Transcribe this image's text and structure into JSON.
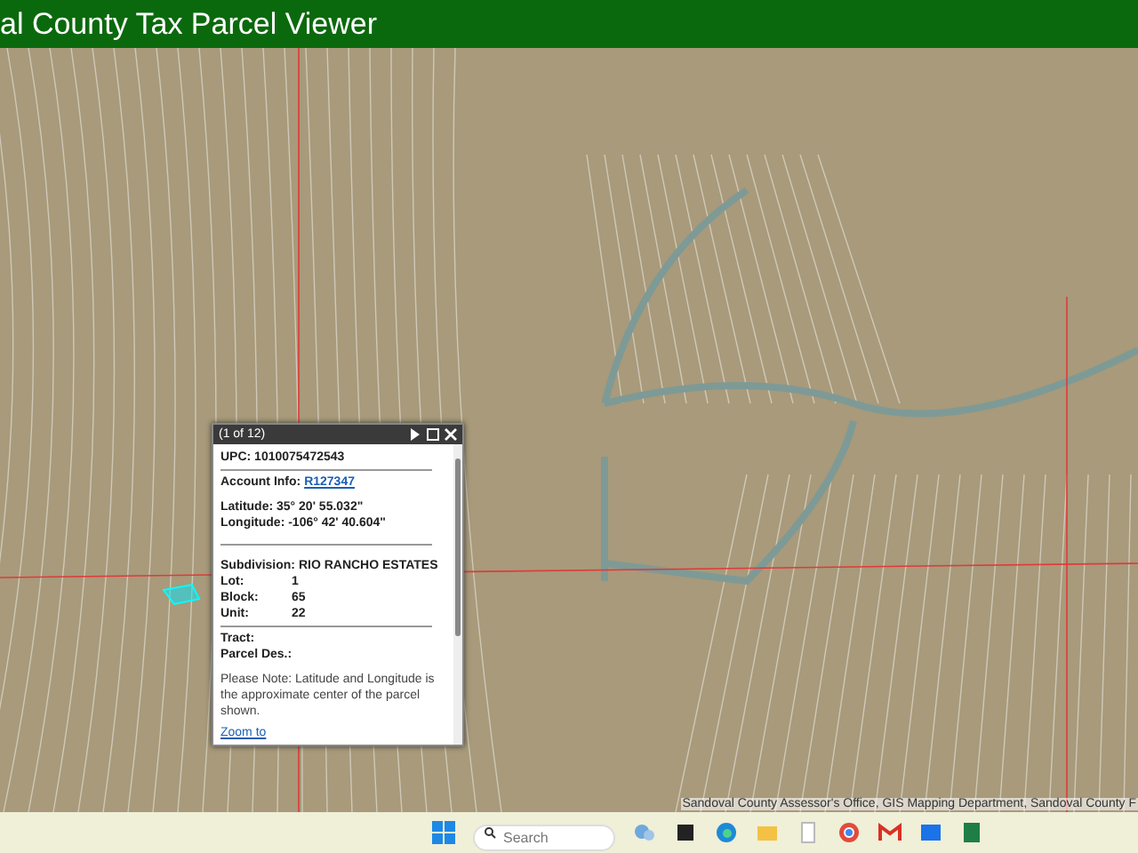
{
  "header": {
    "title": "al County Tax Parcel Viewer"
  },
  "popup": {
    "counter": "(1 of 12)",
    "rows": [
      {
        "kind": "field",
        "label": "UPC:",
        "value": "1010075472543"
      },
      {
        "kind": "rule"
      },
      {
        "kind": "link-field",
        "label": "Account Info:",
        "value": "R127347"
      },
      {
        "kind": "gap"
      },
      {
        "kind": "field",
        "label": "Latitude:",
        "value": "35° 20' 55.032\""
      },
      {
        "kind": "field",
        "label": "Longitude:",
        "value": "-106° 42' 40.604\""
      },
      {
        "kind": "gap"
      },
      {
        "kind": "rule"
      },
      {
        "kind": "gap"
      },
      {
        "kind": "field",
        "label": "Subdivision:",
        "value": "RIO RANCHO ESTATES"
      },
      {
        "kind": "grid",
        "label": "Lot:",
        "value": "1"
      },
      {
        "kind": "grid",
        "label": "Block:",
        "value": "65"
      },
      {
        "kind": "grid",
        "label": "Unit:",
        "value": "22"
      },
      {
        "kind": "rule"
      },
      {
        "kind": "field",
        "label": "Tract:",
        "value": ""
      },
      {
        "kind": "field",
        "label": "Parcel Des.:",
        "value": ""
      },
      {
        "kind": "gap"
      },
      {
        "kind": "note",
        "text": "Please Note: Latitude and Longitude is the approximate center of the parcel shown."
      },
      {
        "kind": "link",
        "text": "Zoom to"
      }
    ]
  },
  "attribution": "Sandoval County Assessor's Office, GIS Mapping Department, Sandoval County F",
  "taskbar": {
    "search": {
      "placeholder": "Search"
    }
  }
}
